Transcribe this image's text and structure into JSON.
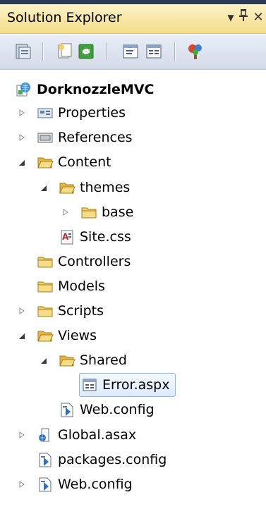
{
  "window": {
    "title": "Solution Explorer",
    "dropdown_glyph": "▼",
    "pin_glyph": "📌",
    "close_glyph": "✕"
  },
  "toolbar": {
    "buttons": [
      {
        "icon": "properties-icon"
      },
      {
        "icon": "show-all-files-icon"
      },
      {
        "icon": "refresh-icon"
      },
      {
        "icon": "view-code-icon"
      },
      {
        "icon": "view-designer-icon"
      },
      {
        "icon": "view-class-diagram-icon"
      }
    ]
  },
  "tree": {
    "project": "DorknozzleMVC",
    "items": [
      {
        "label": "Properties"
      },
      {
        "label": "References"
      },
      {
        "label": "Content"
      },
      {
        "label": "themes"
      },
      {
        "label": "base"
      },
      {
        "label": "Site.css"
      },
      {
        "label": "Controllers"
      },
      {
        "label": "Models"
      },
      {
        "label": "Scripts"
      },
      {
        "label": "Views"
      },
      {
        "label": "Shared"
      },
      {
        "label": "Error.aspx"
      },
      {
        "label": "Web.config"
      },
      {
        "label": "Global.asax"
      },
      {
        "label": "packages.config"
      },
      {
        "label": "Web.config"
      }
    ]
  },
  "colors": {
    "title_bar": "#f4dc8a",
    "toolbar": "#d3dbe8",
    "folder": "#f3cf5c",
    "selection_border": "#8fb7e5"
  }
}
